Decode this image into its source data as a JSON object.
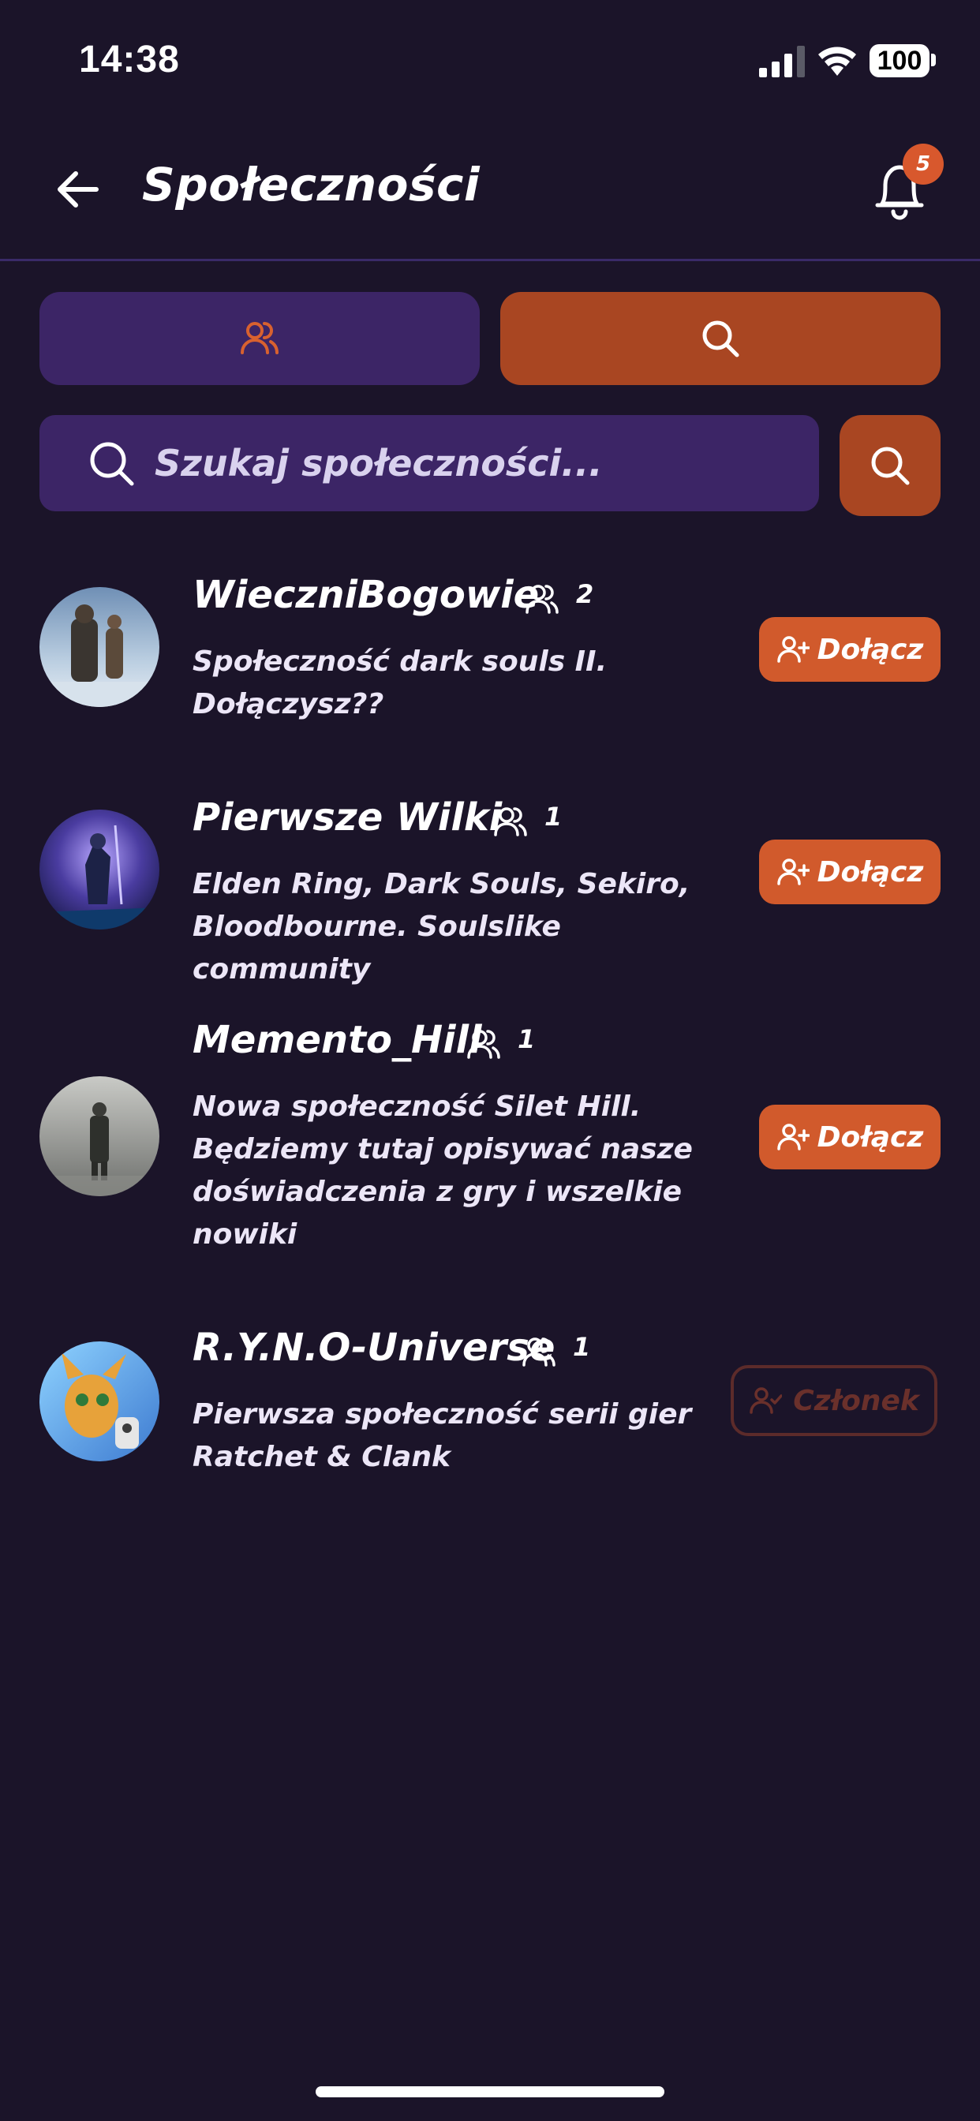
{
  "status_bar": {
    "time": "14:38",
    "battery": "100"
  },
  "header": {
    "title": "Społeczności",
    "notification_count": "5"
  },
  "tabs": [
    {
      "icon": "users-icon",
      "active": false
    },
    {
      "icon": "search-icon",
      "active": true
    }
  ],
  "search": {
    "placeholder": "Szukaj społeczności...",
    "value": ""
  },
  "communities": [
    {
      "name": "WieczniBogowie",
      "members": "2",
      "description_lines": [
        "Społeczność dark souls II.",
        "Dołączysz??"
      ],
      "action": "Dołącz",
      "is_member": false
    },
    {
      "name": "Pierwsze Wilki",
      "members": "1",
      "description_lines": [
        "Elden Ring, Dark Souls, Sekiro,",
        "Bloodbourne. Soulslike community"
      ],
      "action": "Dołącz",
      "is_member": false
    },
    {
      "name": "Memento_Hill",
      "members": "1",
      "description_lines": [
        "Nowa społeczność Silet Hill.",
        "Będziemy tutaj opisywać nasze",
        "doświadczenia z gry i wszelkie",
        "nowiki"
      ],
      "action": "Dołącz",
      "is_member": false
    },
    {
      "name": "R.Y.N.O-Universe",
      "members": "1",
      "description_lines": [
        "Pierwsza społeczność serii gier",
        "Ratchet & Clank"
      ],
      "action": "Członek",
      "is_member": true
    }
  ],
  "colors": {
    "background": "#1b1429",
    "panel": "#3c2566",
    "accent": "#d15a2c",
    "accent_dark": "#a94622",
    "member_outline": "#5c2b2a"
  }
}
